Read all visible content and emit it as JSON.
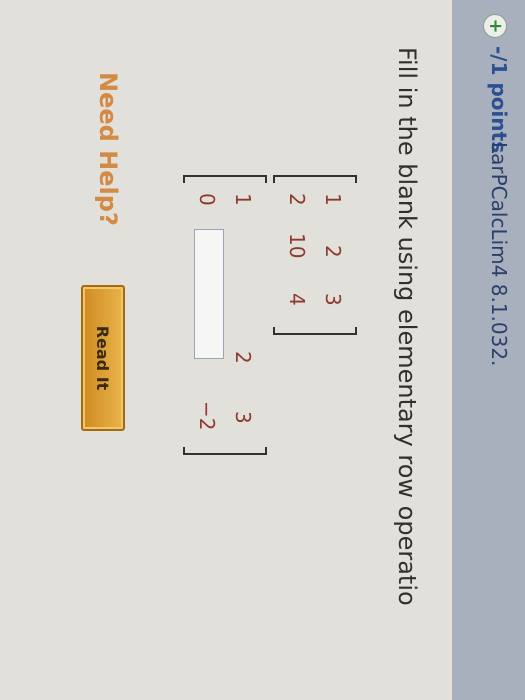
{
  "header": {
    "points_label": "-/1 points",
    "problem_id": "LarPCalcLim4 8.1.032."
  },
  "question": {
    "instruction": "Fill in the blank using elementary row operatio",
    "matrix_original": [
      [
        "1",
        "2",
        "3"
      ],
      [
        "2",
        "10",
        "4"
      ]
    ],
    "matrix_result_row1": [
      "1",
      "2",
      "3"
    ],
    "matrix_result_row2": [
      "0",
      "",
      "−2"
    ],
    "answer_value": ""
  },
  "help": {
    "need_help": "Need Help?",
    "read_it": "Read It"
  },
  "icons": {
    "add": "plus-circle-icon"
  },
  "colors": {
    "header_bg": "#a7b0bc",
    "points": "#2a4f93",
    "entries": "#8e3a2e",
    "need_help": "#d28a45",
    "button": "#d99a30"
  }
}
